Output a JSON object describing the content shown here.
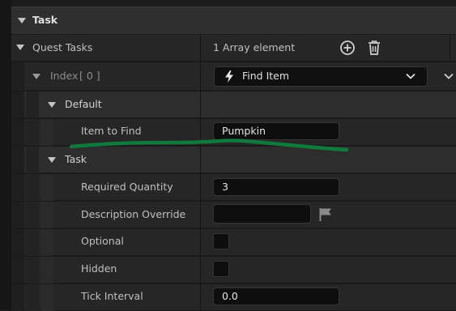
{
  "panel": {
    "section_task": "Task",
    "quest_tasks_label": "Quest Tasks",
    "array_summary": "1 Array element",
    "add_icon": "plus-circle-icon",
    "delete_icon": "trash-icon"
  },
  "index": {
    "label": "Index",
    "bracket_value": "[ 0 ]",
    "class_selector": {
      "icon": "lightning-bolt-icon",
      "value": "Find Item"
    }
  },
  "default_section": {
    "title": "Default",
    "item_to_find_label": "Item to Find",
    "item_to_find_value": "Pumpkin"
  },
  "task_section": {
    "title": "Task",
    "required_quantity_label": "Required Quantity",
    "required_quantity_value": "3",
    "description_override_label": "Description Override",
    "description_override_value": "",
    "description_flag_icon": "flag-icon",
    "optional_label": "Optional",
    "optional_checked": false,
    "hidden_label": "Hidden",
    "hidden_checked": false,
    "tick_interval_label": "Tick Interval",
    "tick_interval_value": "0.0"
  },
  "annotation": {
    "stroke_color": "#0f7a3c"
  },
  "colors": {
    "background": "#1b1b1b",
    "row_background": "#242424",
    "header_background": "#2e2e2e",
    "field_background": "#0e0e0e",
    "text": "#c0c0c0"
  }
}
